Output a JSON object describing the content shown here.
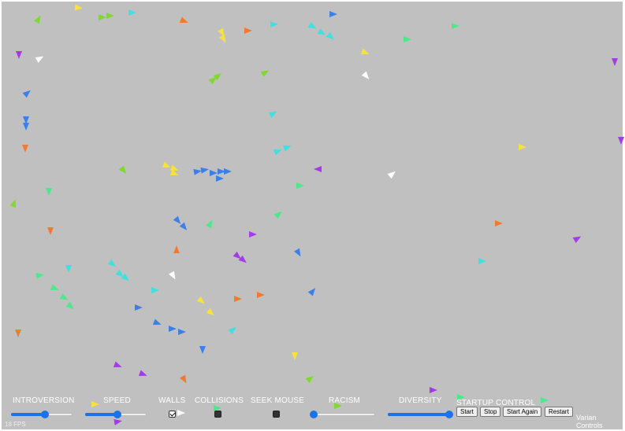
{
  "colors": {
    "background": "#c0c0c0",
    "accent": "#1a73e8",
    "boid_palette": [
      "#f7e13b",
      "#7fd92e",
      "#4de88a",
      "#3ee0e0",
      "#3b7fe8",
      "#a33be8",
      "#f07a30",
      "#ffffff"
    ]
  },
  "controls": {
    "introversion": {
      "label": "INTROVERSION",
      "value": 0.55
    },
    "speed": {
      "label": "SPEED",
      "value": 0.52
    },
    "walls": {
      "label": "WALLS",
      "checked": true
    },
    "collisions": {
      "label": "COLLISIONS",
      "checked": false
    },
    "seek_mouse": {
      "label": "SEEK MOUSE",
      "checked": false
    },
    "racism": {
      "label": "RACISM",
      "value": 0.0
    },
    "diversity": {
      "label": "DIVERSITY",
      "value": 1.0
    }
  },
  "startup": {
    "label": "STARTUP CONTROL",
    "start": "Start",
    "stop": "Stop",
    "start_again": "Start Again",
    "restart": "Restart"
  },
  "fps": "18 FPS",
  "credit": "Varian Controls"
}
